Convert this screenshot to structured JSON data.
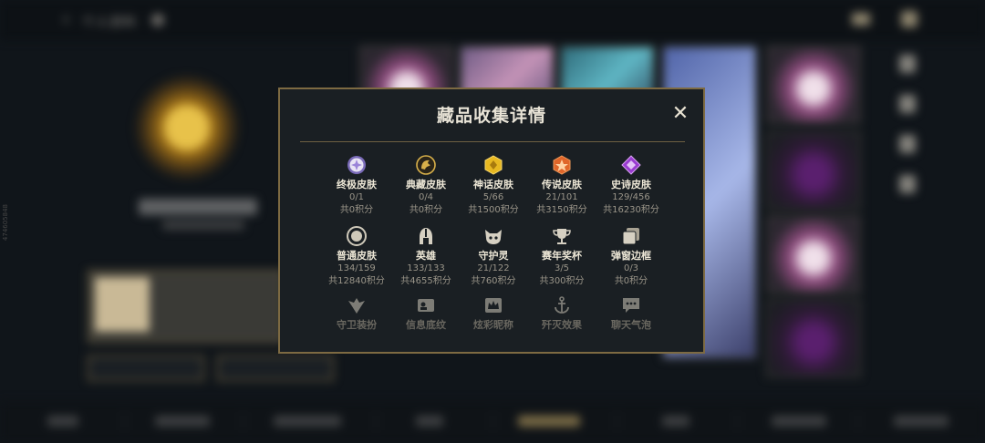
{
  "background": {
    "title": "个人资料"
  },
  "modal": {
    "title": "藏品收集详情",
    "close_label": "✕",
    "row1": [
      {
        "label": "终极皮肤",
        "count": "0/1",
        "points": "共0积分"
      },
      {
        "label": "典藏皮肤",
        "count": "0/4",
        "points": "共0积分"
      },
      {
        "label": "神话皮肤",
        "count": "5/66",
        "points": "共1500积分"
      },
      {
        "label": "传说皮肤",
        "count": "21/101",
        "points": "共3150积分"
      },
      {
        "label": "史诗皮肤",
        "count": "129/456",
        "points": "共16230积分"
      }
    ],
    "row2": [
      {
        "label": "普通皮肤",
        "count": "134/159",
        "points": "共12840积分"
      },
      {
        "label": "英雄",
        "count": "133/133",
        "points": "共4655积分"
      },
      {
        "label": "守护灵",
        "count": "21/122",
        "points": "共760积分"
      },
      {
        "label": "赛年奖杯",
        "count": "3/5",
        "points": "共300积分"
      },
      {
        "label": "弹窗边框",
        "count": "0/3",
        "points": "共0积分"
      }
    ],
    "row3": [
      {
        "label": "守卫装扮"
      },
      {
        "label": "信息底纹"
      },
      {
        "label": "炫彩昵称"
      },
      {
        "label": "歼灭效果"
      },
      {
        "label": "聊天气泡"
      }
    ]
  },
  "colors": {
    "accent_gold": "#7d6a42",
    "modal_bg": "#1a1f23",
    "ultimate": "#b9a6e8",
    "prestige": "#d8b04a",
    "mythic": "#e8b821",
    "legendary": "#e0662a",
    "epic": "#9a3bd0"
  }
}
